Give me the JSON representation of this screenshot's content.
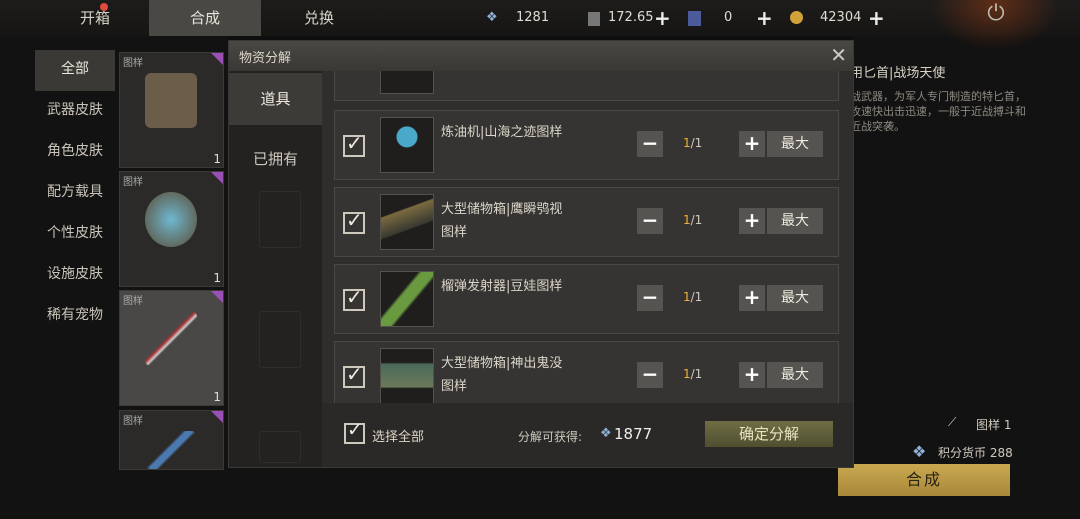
{
  "top_tabs": [
    "开箱",
    "合成",
    "兑换"
  ],
  "resources": {
    "gem": "1281",
    "card": "172.65",
    "ticket": "0",
    "coin": "42304"
  },
  "left_nav": [
    "全部",
    "武器皮肤",
    "角色皮肤",
    "配方载具",
    "个性皮肤",
    "设施皮肤",
    "稀有宠物"
  ],
  "grid_cards": [
    {
      "tag": "图样",
      "count": "1"
    },
    {
      "tag": "图样",
      "count": "1"
    },
    {
      "tag": "图样",
      "count": "1"
    },
    {
      "tag": "图样",
      "count": ""
    }
  ],
  "right_panel": {
    "title": "用匕首|战场天使",
    "desc": "战武器，为军人专门制造的特匕首，攻速快出击迅速，一般于近战搏斗和近战突袭。",
    "item1": "图样 1",
    "item2": "积分货币 288",
    "synth_button": "合成"
  },
  "modal": {
    "title": "物资分解",
    "tabs": [
      "道具",
      "已拥有"
    ],
    "rows": [
      {
        "name": "炼油机|山海之迹图样",
        "qty": "1",
        "total": "/1"
      },
      {
        "name": "大型储物箱|鹰瞬鸮视图样",
        "qty": "1",
        "total": "/1"
      },
      {
        "name": "榴弹发射器|豆娃图样",
        "qty": "1",
        "total": "/1"
      },
      {
        "name": "大型储物箱|神出鬼没图样",
        "qty": "1",
        "total": "/1"
      }
    ],
    "max_label": "最大",
    "select_all": "选择全部",
    "gain_label": "分解可获得:",
    "gain_value": "1877",
    "confirm": "确定分解"
  },
  "colors": {
    "accent_gold": "#c9a850",
    "qty_orange": "#f0b13a",
    "rarity_purple": "#9a4fb5"
  }
}
